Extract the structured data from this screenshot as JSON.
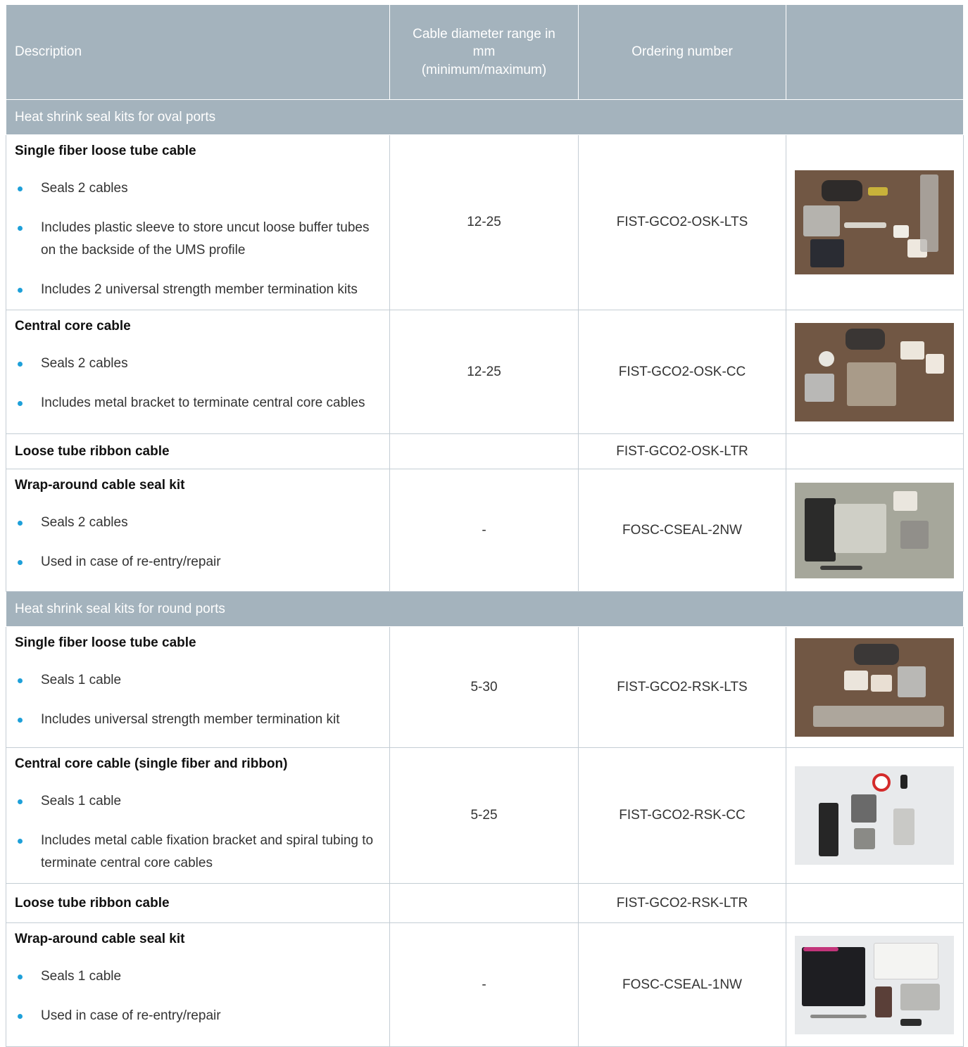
{
  "header": {
    "description": "Description",
    "diameter_line1": "Cable diameter range in",
    "diameter_line2": "mm",
    "diameter_line3": "(minimum/maximum)",
    "ordering": "Ordering number",
    "image": ""
  },
  "sections": [
    {
      "title": "Heat shrink seal kits for oval ports",
      "rows": [
        {
          "title": "Single fiber loose tube cable",
          "bullets": [
            "Seals 2 cables",
            "Includes plastic sleeve to store uncut loose buffer tubes on the backside of the UMS profile",
            "Includes 2 universal strength member termination kits"
          ],
          "diameter": "12-25",
          "ordering": "FIST-GCO2-OSK-LTS"
        },
        {
          "title": "Central core cable",
          "bullets": [
            "Seals 2 cables",
            "Includes metal bracket to terminate central core cables"
          ],
          "diameter": "12-25",
          "ordering": "FIST-GCO2-OSK-CC"
        },
        {
          "title": "Loose tube ribbon cable",
          "bullets": [],
          "diameter": "",
          "ordering": "FIST-GCO2-OSK-LTR"
        },
        {
          "title": "Wrap-around cable seal kit",
          "bullets": [
            "Seals 2 cables",
            "Used in case of re-entry/repair"
          ],
          "diameter": "-",
          "ordering": "FOSC-CSEAL-2NW"
        }
      ]
    },
    {
      "title": "Heat shrink seal kits for round ports",
      "rows": [
        {
          "title": "Single fiber loose tube cable",
          "bullets": [
            "Seals 1 cable",
            "Includes universal strength member termination kit"
          ],
          "diameter": "5-30",
          "ordering": "FIST-GCO2-RSK-LTS"
        },
        {
          "title": "Central core cable (single fiber and ribbon)",
          "bullets": [
            "Seals 1 cable",
            "Includes metal cable fixation bracket and spiral tubing to terminate central core cables"
          ],
          "diameter": "5-25",
          "ordering": "FIST-GCO2-RSK-CC"
        },
        {
          "title": "Loose tube ribbon cable",
          "bullets": [],
          "diameter": "",
          "ordering": "FIST-GCO2-RSK-LTR"
        },
        {
          "title": "Wrap-around cable seal kit",
          "bullets": [
            "Seals 1 cable",
            "Used in case of re-entry/repair"
          ],
          "diameter": "-",
          "ordering": "FOSC-CSEAL-1NW"
        }
      ]
    }
  ],
  "colors": {
    "header_bg": "#a4b3bd",
    "bullet": "#1ea0d9",
    "border": "#c4cdd4"
  }
}
